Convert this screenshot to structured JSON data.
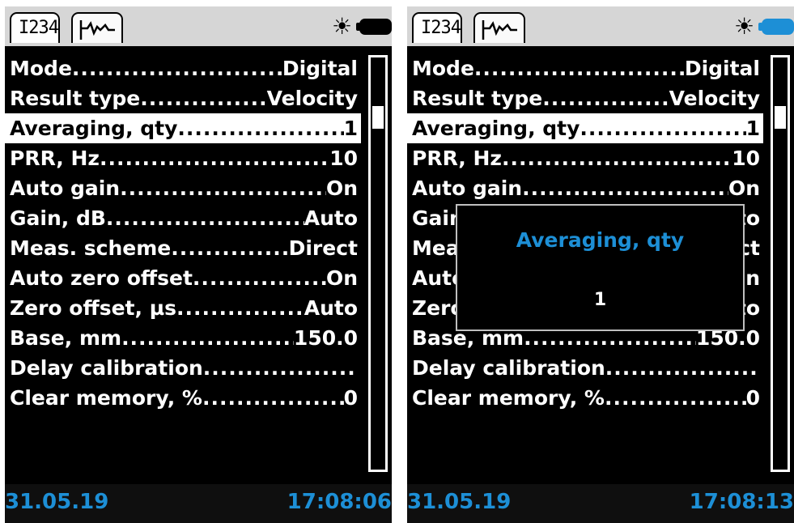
{
  "colors": {
    "accent": "#1d8fd6",
    "background": "#000000",
    "topbar": "#d6d6d6"
  },
  "screens": [
    {
      "tab_digital_label": "I234",
      "tab_waveform_icon": "waveform-icon",
      "brightness_icon": "sun-icon",
      "battery_color": "#000000",
      "rows": [
        {
          "label": "Mode",
          "value": "Digital"
        },
        {
          "label": "Result type",
          "value": "Velocity"
        },
        {
          "label": "Averaging, qty",
          "value": "1"
        },
        {
          "label": "PRR, Hz",
          "value": "10"
        },
        {
          "label": "Auto gain",
          "value": "On"
        },
        {
          "label": "Gain, dB",
          "value": "Auto"
        },
        {
          "label": "Meas. scheme",
          "value": "Direct"
        },
        {
          "label": "Auto zero offset",
          "value": "On"
        },
        {
          "label": "Zero offset, µs",
          "value": "Auto"
        },
        {
          "label": "Base, mm",
          "value": "150.0"
        },
        {
          "label": "Delay calibration",
          "value": ""
        },
        {
          "label": "Clear memory, %",
          "value": "0"
        }
      ],
      "selected_index": 2,
      "date": "31.05.19",
      "time": "17:08:06"
    },
    {
      "tab_digital_label": "I234",
      "tab_waveform_icon": "waveform-icon",
      "brightness_icon": "sun-icon",
      "battery_color": "#1d8fd6",
      "rows": [
        {
          "label": "Mode",
          "value": "Digital"
        },
        {
          "label": "Result type",
          "value": "Velocity"
        },
        {
          "label": "Averaging, qty",
          "value": "1"
        },
        {
          "label": "PRR, Hz",
          "value": "10"
        },
        {
          "label": "Auto gain",
          "value": "On"
        },
        {
          "label": "Gain, dB",
          "value": "Auto"
        },
        {
          "label": "Meas. scheme",
          "value": "Direct"
        },
        {
          "label": "Auto zero offset",
          "value": "On"
        },
        {
          "label": "Zero offset, µs",
          "value": "Auto"
        },
        {
          "label": "Base, mm",
          "value": "150.0"
        },
        {
          "label": "Delay calibration",
          "value": ""
        },
        {
          "label": "Clear memory, %",
          "value": "0"
        }
      ],
      "selected_index": 2,
      "date": "31.05.19",
      "time": "17:08:13",
      "dialog": {
        "title": "Averaging, qty",
        "value": "1"
      }
    }
  ]
}
